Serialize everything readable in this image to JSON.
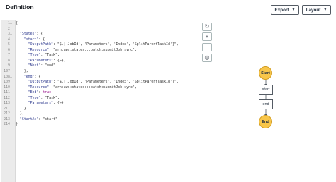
{
  "header": {
    "title": "Definition",
    "export_label": "Export",
    "layout_label": "Layout"
  },
  "editor": {
    "lines": [
      {
        "n": "1",
        "fold": "▾",
        "t": "{"
      },
      {
        "n": "2",
        "fold": "",
        "t": ""
      },
      {
        "n": "3",
        "fold": "▾",
        "t": "  \"States\": {"
      },
      {
        "n": "4",
        "fold": "▾",
        "t": "    \"start\": {"
      },
      {
        "n": "5",
        "fold": "",
        "t": "      \"OutputPath\": \"$.['JobId', 'Parameters', 'Index', 'SplitParentTaskId']\","
      },
      {
        "n": "6",
        "fold": "",
        "t": "      \"Resource\": \"arn:aws:states:::batch:submitJob.sync\","
      },
      {
        "n": "7",
        "fold": "",
        "t": "      \"Type\": \"Task\","
      },
      {
        "n": "8",
        "fold": "",
        "t": "      \"Parameters\": {↔},"
      },
      {
        "n": "9",
        "fold": "",
        "t": "      \"Next\": \"end\""
      },
      {
        "n": "107",
        "fold": "",
        "t": "    },"
      },
      {
        "n": "108",
        "fold": "▾",
        "t": "    \"end\": {"
      },
      {
        "n": "109",
        "fold": "",
        "t": "      \"OutputPath\": \"$.['JobId', 'Parameters', 'Index', 'SplitParentTaskId']\","
      },
      {
        "n": "110",
        "fold": "",
        "t": "      \"Resource\": \"arn:aws:states:::batch:submitJob.sync\","
      },
      {
        "n": "111",
        "fold": "",
        "t": "      \"End\": true,"
      },
      {
        "n": "112",
        "fold": "",
        "t": "      \"Type\": \"Task\","
      },
      {
        "n": "113",
        "fold": "",
        "t": "      \"Parameters\": {↔}"
      },
      {
        "n": "211",
        "fold": "",
        "t": "    }"
      },
      {
        "n": "212",
        "fold": "",
        "t": "  },"
      },
      {
        "n": "213",
        "fold": "",
        "t": "  \"StartAt\": \"start\""
      },
      {
        "n": "214",
        "fold": "",
        "t": "}"
      }
    ]
  },
  "graph_tools": [
    {
      "name": "refresh-icon",
      "glyph": "↻"
    },
    {
      "name": "zoom-in-icon",
      "glyph": "+"
    },
    {
      "name": "zoom-out-icon",
      "glyph": "−"
    },
    {
      "name": "center-icon",
      "glyph": "◎"
    }
  ],
  "graph": {
    "start_label": "Start",
    "state1_label": "start",
    "state2_label": "end",
    "end_label": "End"
  }
}
